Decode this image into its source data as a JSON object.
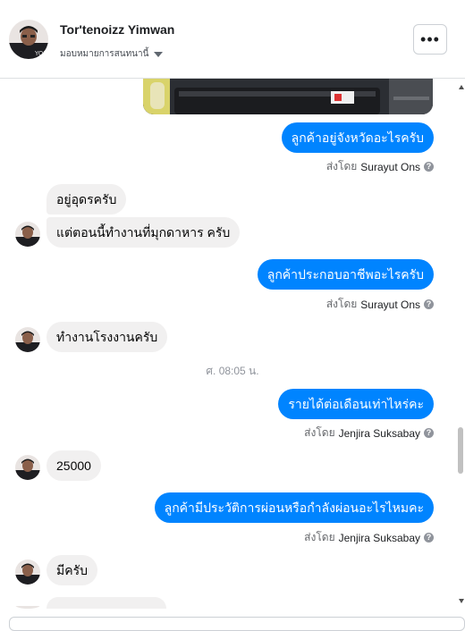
{
  "header": {
    "name": "Tor'tenoizz Yimwan",
    "assign_label": "มอบหมายการสนทนานี้",
    "more_label": "•••"
  },
  "sent_by_prefix": "ส่งโดย",
  "messages": {
    "m1": {
      "text": "ลูกค้าอยู่จังหวัดอะไรครับ",
      "sender": "Surayut Ons"
    },
    "m2": {
      "text": "อยู่อุดรครับ"
    },
    "m3": {
      "text": "แต่ตอนนี้ทำงานที่มุกดาหาร ครับ"
    },
    "m4": {
      "text": "ลูกค้าประกอบอาชีพอะไรครับ",
      "sender": "Surayut Ons"
    },
    "m5": {
      "text": "ทำงานโรงงานครับ"
    },
    "timestamp": "ศ. 08:05 น.",
    "m6": {
      "text": "รายได้ต่อเดือนเท่าไหร่คะ",
      "sender": "Jenjira Suksabay"
    },
    "m7": {
      "text": "25000"
    },
    "m8": {
      "text": "ลูกค้ามีประวัติการผ่อนหรือกำลังผ่อนอะไรไหมคะ",
      "sender": "Jenjira Suksabay"
    },
    "m9": {
      "text": "มีครับ"
    }
  }
}
